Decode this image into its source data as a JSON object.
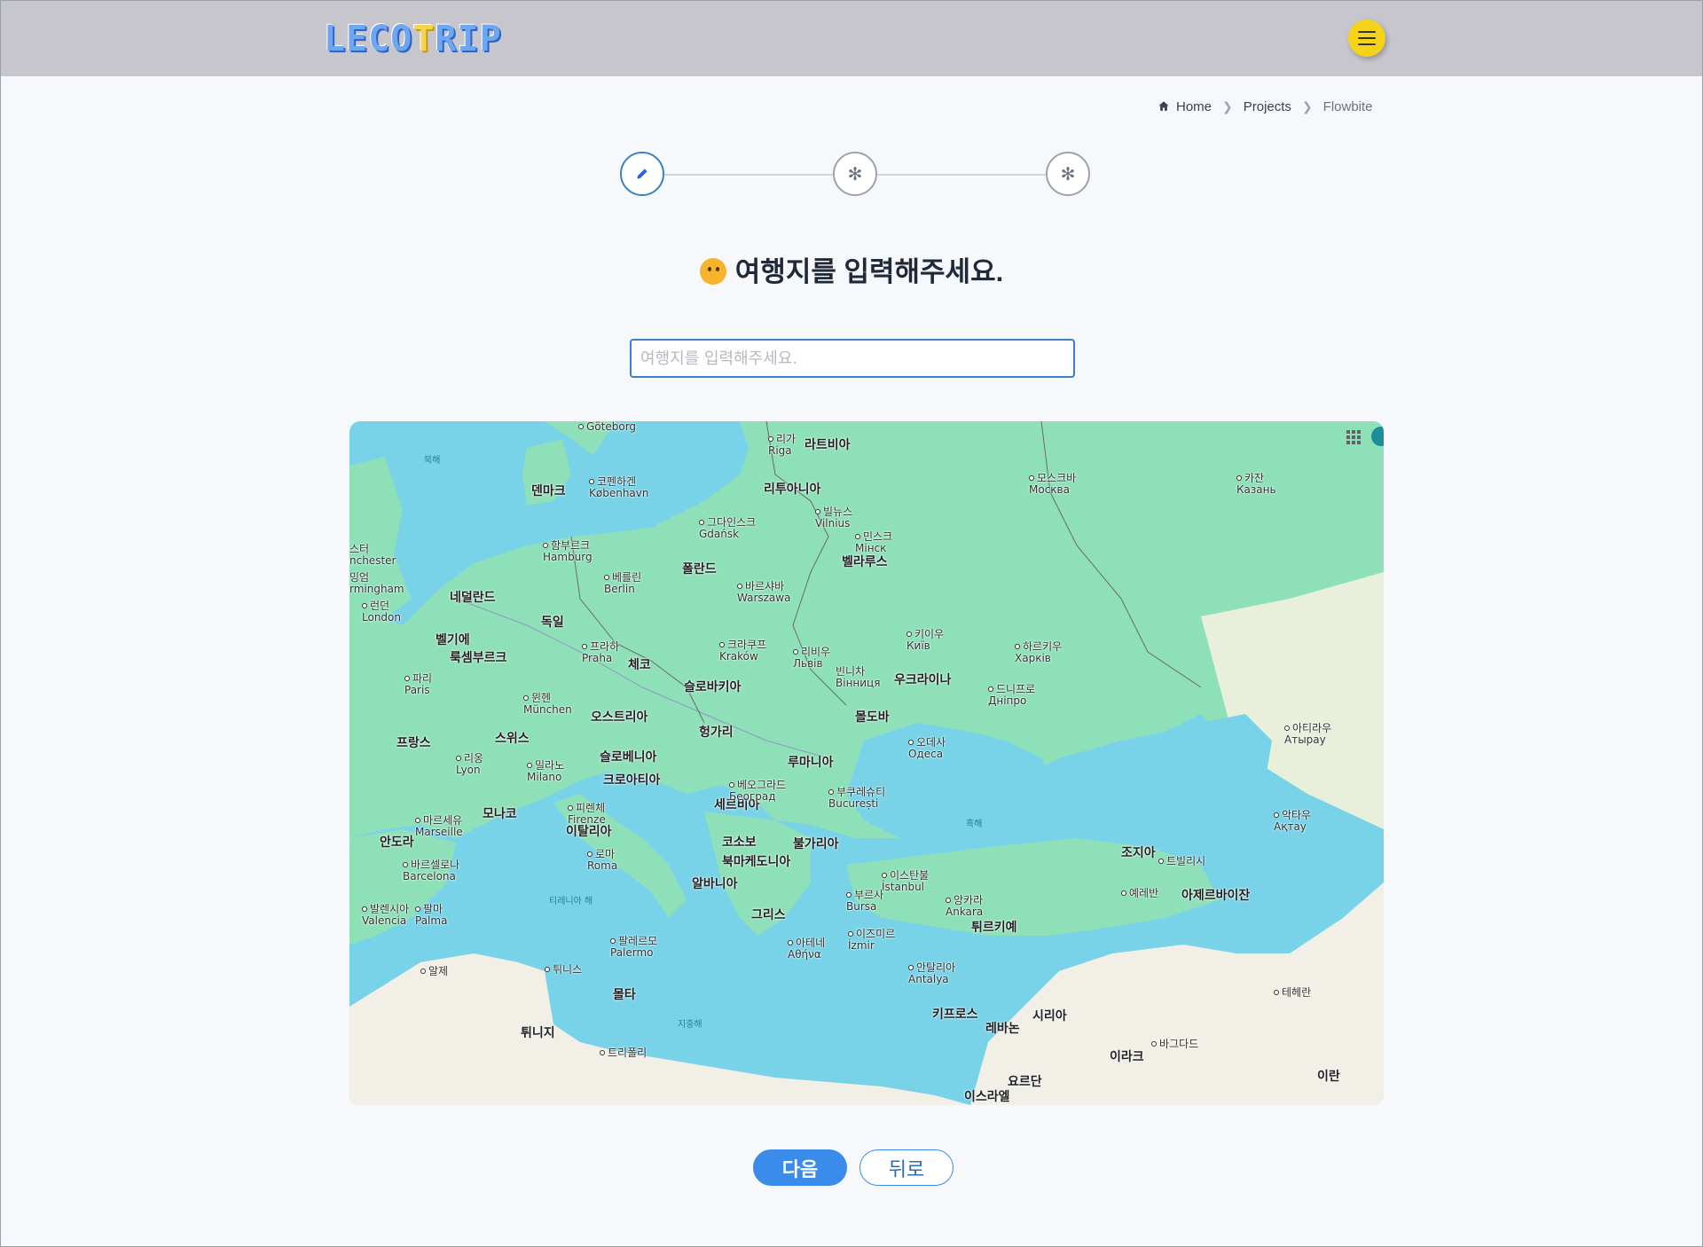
{
  "header": {
    "logo_text_1": "LECO",
    "logo_text_2": "T",
    "logo_text_3": "RIP",
    "menu_icon": "hamburger-icon"
  },
  "breadcrumb": {
    "items": [
      "Home",
      "Projects",
      "Flowbite"
    ]
  },
  "stepper": {
    "step_icons": [
      "pencil-icon",
      "asterisk-icon",
      "asterisk-icon"
    ],
    "active_step": 1
  },
  "main": {
    "heading": "여행지를 입력해주세요.",
    "input_placeholder": "여행지를 입력해주세요."
  },
  "map": {
    "countries": [
      "덴마크",
      "리투아니아",
      "라트비아",
      "벨라루스",
      "폴란드",
      "독일",
      "네덜란드",
      "벨기에",
      "룩셈부르크",
      "체코",
      "슬로바키아",
      "우크라이나",
      "오스트리아",
      "몰도바",
      "헝가리",
      "프랑스",
      "스위스",
      "슬로베니아",
      "크로아티아",
      "루마니아",
      "세르비아",
      "모나코",
      "이탈리아",
      "안도라",
      "코소보",
      "불가리아",
      "북마케도니아",
      "알바니아",
      "그리스",
      "튀르키예",
      "조지아",
      "아제르바이잔",
      "시리아",
      "키프로스",
      "레바논",
      "이라크",
      "요르단",
      "이스라엘",
      "이란",
      "몰타",
      "튀니지"
    ],
    "cities": [
      {
        "ko": "코펜하겐",
        "en": "København"
      },
      {
        "ko": "함부르크",
        "en": "Hamburg"
      },
      {
        "ko": "그다인스크",
        "en": "Gdańsk"
      },
      {
        "ko": "빌뉴스",
        "en": "Vilnius"
      },
      {
        "ko": "민스크",
        "en": "Мінск"
      },
      {
        "ko": "모스크바",
        "en": "Москва"
      },
      {
        "ko": "카잔",
        "en": "Казань"
      },
      {
        "ko": "베를린",
        "en": "Berlin"
      },
      {
        "ko": "바르샤바",
        "en": "Warszawa"
      },
      {
        "ko": "런던",
        "en": "London"
      },
      {
        "ko": "프라하",
        "en": "Praha"
      },
      {
        "ko": "크라쿠프",
        "en": "Kraków"
      },
      {
        "ko": "리비우",
        "en": "Львів"
      },
      {
        "ko": "키이우",
        "en": "Київ"
      },
      {
        "ko": "하르키우",
        "en": "Харків"
      },
      {
        "ko": "파리",
        "en": "Paris"
      },
      {
        "ko": "뮌헨",
        "en": "München"
      },
      {
        "ko": "드니프로",
        "en": "Дніпро"
      },
      {
        "ko": "오데사",
        "en": "Одеса"
      },
      {
        "ko": "리옹",
        "en": "Lyon"
      },
      {
        "ko": "밀라노",
        "en": "Milano"
      },
      {
        "ko": "부쿠레슈티",
        "en": "București"
      },
      {
        "ko": "마르세유",
        "en": "Marseille"
      },
      {
        "ko": "피렌체",
        "en": "Firenze"
      },
      {
        "ko": "로마",
        "en": "Roma"
      },
      {
        "ko": "바르셀로나",
        "en": "Barcelona"
      },
      {
        "ko": "이스탄불",
        "en": "İstanbul"
      },
      {
        "ko": "부르사",
        "en": "Bursa"
      },
      {
        "ko": "앙카라",
        "en": "Ankara"
      },
      {
        "ko": "발렌시아",
        "en": "Valencia"
      },
      {
        "ko": "팔마",
        "en": "Palma"
      },
      {
        "ko": "팔레르모",
        "en": "Palermo"
      },
      {
        "ko": "아테네",
        "en": "Αθήνα"
      },
      {
        "ko": "이즈미르",
        "en": "İzmir"
      },
      {
        "ko": "안탈리아",
        "en": "Antalya"
      },
      {
        "ko": "트빌리시",
        "en": ""
      },
      {
        "ko": "예레반",
        "en": ""
      },
      {
        "ko": "악타우",
        "en": "Ақтау"
      },
      {
        "ko": "아티라우",
        "en": "Атырау"
      },
      {
        "ko": "알제",
        "en": ""
      },
      {
        "ko": "튀니스",
        "en": ""
      },
      {
        "ko": "트리폴리",
        "en": ""
      },
      {
        "ko": "바그다드",
        "en": ""
      },
      {
        "ko": "테헤란",
        "en": ""
      },
      {
        "ko": "리가",
        "en": "Riga"
      },
      {
        "ko": "스터",
        "en": "nchester"
      },
      {
        "ko": "밍엄",
        "en": "rmingham"
      },
      {
        "ko": "빈니차",
        "en": "Вінниця"
      },
      {
        "ko": "베오그라드",
        "en": "Београд"
      }
    ],
    "seas": [
      "북해",
      "흑해",
      "티레니아 해",
      "지중해"
    ],
    "top_labels": [
      "Göteborg"
    ],
    "colors": {
      "water": "#78d3e8",
      "land": "#8ee0b8",
      "south_land": "#f1efe6"
    }
  },
  "actions": {
    "next_label": "다음",
    "back_label": "뒤로"
  }
}
